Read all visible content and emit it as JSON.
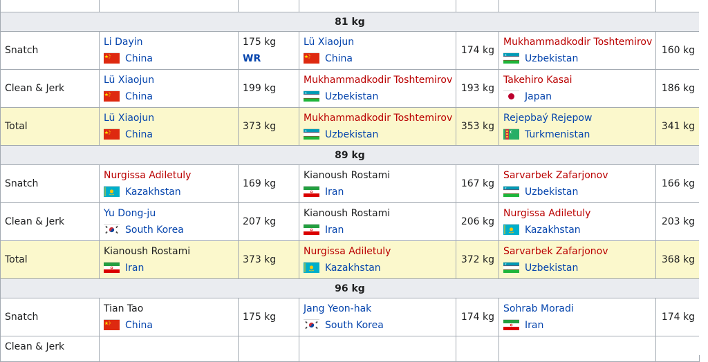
{
  "sections": [
    {
      "title": "81 kg",
      "rows": [
        {
          "event": "Snatch",
          "gold": {
            "name": "Li Dayin",
            "name_color": "blue",
            "country": "China",
            "flag": "china",
            "weight": "175 kg",
            "note": "WR"
          },
          "silver": {
            "name": "Lü Xiaojun",
            "name_color": "blue",
            "country": "China",
            "flag": "china",
            "weight": "174 kg"
          },
          "bronze": {
            "name": "Mukhammadkodir Toshtemirov",
            "name_color": "red",
            "country": "Uzbekistan",
            "flag": "uzbekistan",
            "weight": "160 kg"
          }
        },
        {
          "event": "Clean & Jerk",
          "gold": {
            "name": "Lü Xiaojun",
            "name_color": "blue",
            "country": "China",
            "flag": "china",
            "weight": "199 kg"
          },
          "silver": {
            "name": "Mukhammadkodir Toshtemirov",
            "name_color": "red",
            "country": "Uzbekistan",
            "flag": "uzbekistan",
            "weight": "193 kg"
          },
          "bronze": {
            "name": "Takehiro Kasai",
            "name_color": "red",
            "country": "Japan",
            "flag": "japan",
            "weight": "186 kg"
          }
        },
        {
          "event": "Total",
          "total": true,
          "gold": {
            "name": "Lü Xiaojun",
            "name_color": "blue",
            "country": "China",
            "flag": "china",
            "weight": "373 kg"
          },
          "silver": {
            "name": "Mukhammadkodir Toshtemirov",
            "name_color": "red",
            "country": "Uzbekistan",
            "flag": "uzbekistan",
            "weight": "353 kg"
          },
          "bronze": {
            "name": "Rejepbaý Rejepow",
            "name_color": "blue",
            "country": "Turkmenistan",
            "flag": "turkmenistan",
            "weight": "341 kg"
          }
        }
      ]
    },
    {
      "title": "89 kg",
      "rows": [
        {
          "event": "Snatch",
          "gold": {
            "name": "Nurgissa Adiletuly",
            "name_color": "red",
            "country": "Kazakhstan",
            "flag": "kazakhstan",
            "weight": "169 kg"
          },
          "silver": {
            "name": "Kianoush Rostami",
            "name_color": "dark",
            "country": "Iran",
            "flag": "iran",
            "weight": "167 kg"
          },
          "bronze": {
            "name": "Sarvarbek Zafarjonov",
            "name_color": "red",
            "country": "Uzbekistan",
            "flag": "uzbekistan",
            "weight": "166 kg"
          }
        },
        {
          "event": "Clean & Jerk",
          "gold": {
            "name": "Yu Dong-ju",
            "name_color": "blue",
            "country": "South Korea",
            "flag": "korea",
            "weight": "207 kg"
          },
          "silver": {
            "name": "Kianoush Rostami",
            "name_color": "dark",
            "country": "Iran",
            "flag": "iran",
            "weight": "206 kg"
          },
          "bronze": {
            "name": "Nurgissa Adiletuly",
            "name_color": "red",
            "country": "Kazakhstan",
            "flag": "kazakhstan",
            "weight": "203 kg"
          }
        },
        {
          "event": "Total",
          "total": true,
          "gold": {
            "name": "Kianoush Rostami",
            "name_color": "dark",
            "country": "Iran",
            "flag": "iran",
            "weight": "373 kg"
          },
          "silver": {
            "name": "Nurgissa Adiletuly",
            "name_color": "red",
            "country": "Kazakhstan",
            "flag": "kazakhstan",
            "weight": "372 kg"
          },
          "bronze": {
            "name": "Sarvarbek Zafarjonov",
            "name_color": "red",
            "country": "Uzbekistan",
            "flag": "uzbekistan",
            "weight": "368 kg"
          }
        }
      ]
    },
    {
      "title": "96 kg",
      "rows": [
        {
          "event": "Snatch",
          "gold": {
            "name": "Tian Tao",
            "name_color": "dark",
            "country": "China",
            "flag": "china",
            "weight": "175 kg"
          },
          "silver": {
            "name": "Jang Yeon-hak",
            "name_color": "blue",
            "country": "South Korea",
            "flag": "korea",
            "weight": "174 kg"
          },
          "bronze": {
            "name": "Sohrab Moradi",
            "name_color": "blue",
            "country": "Iran",
            "flag": "iran",
            "weight": "174 kg"
          }
        }
      ]
    }
  ],
  "partial_last_row": {
    "event": "Clean & Jerk"
  },
  "colors": {
    "link_blue": "#0645ad",
    "redlink": "#ba0000",
    "header_bg": "#eaecf0",
    "total_bg": "#fbf8cc",
    "border": "#a2a9b1"
  }
}
